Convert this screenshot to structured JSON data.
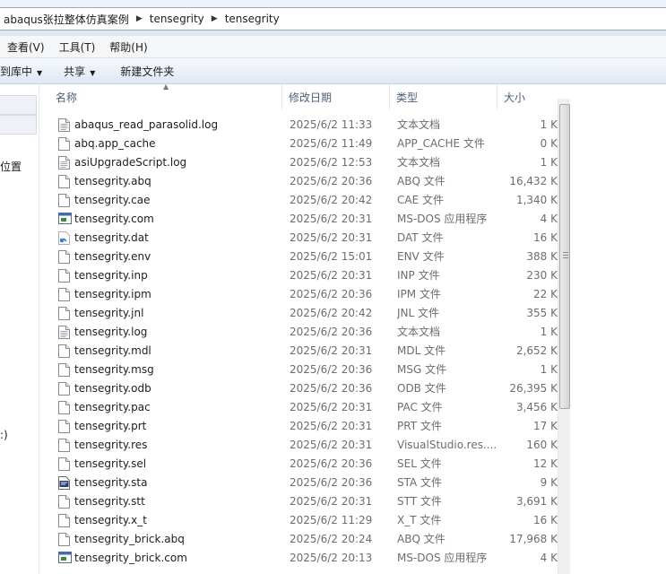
{
  "address": {
    "crumbs": [
      "abaqus张拉整体仿真案例",
      "tensegrity",
      "tensegrity"
    ]
  },
  "menu": {
    "items": [
      "查看(V)",
      "工具(T)",
      "帮助(H)"
    ]
  },
  "commands": {
    "organize": "到库中",
    "share": "共享",
    "new_folder": "新建文件夹"
  },
  "nav": {
    "partial_label1": "位置",
    "partial_label2": ":)"
  },
  "columns": {
    "name": "名称",
    "date": "修改日期",
    "type": "类型",
    "size": "大小"
  },
  "files": [
    {
      "name": "abaqus_read_parasolid.log",
      "date": "2025/6/2 11:33",
      "type": "文本文档",
      "size": "1 K",
      "icon": "text-file-icon"
    },
    {
      "name": "abq.app_cache",
      "date": "2025/6/2 11:49",
      "type": "APP_CACHE 文件",
      "size": "0 K",
      "icon": "blank-file-icon"
    },
    {
      "name": "asiUpgradeScript.log",
      "date": "2025/6/2 12:53",
      "type": "文本文档",
      "size": "1 K",
      "icon": "text-file-icon"
    },
    {
      "name": "tensegrity.abq",
      "date": "2025/6/2 20:36",
      "type": "ABQ 文件",
      "size": "16,432 K",
      "icon": "blank-file-icon"
    },
    {
      "name": "tensegrity.cae",
      "date": "2025/6/2 20:42",
      "type": "CAE 文件",
      "size": "1,340 K",
      "icon": "blank-file-icon"
    },
    {
      "name": "tensegrity.com",
      "date": "2025/6/2 20:31",
      "type": "MS-DOS 应用程序",
      "size": "4 K",
      "icon": "msdos-app-icon"
    },
    {
      "name": "tensegrity.dat",
      "date": "2025/6/2 20:31",
      "type": "DAT 文件",
      "size": "16 K",
      "icon": "dat-file-icon"
    },
    {
      "name": "tensegrity.env",
      "date": "2025/6/2 15:01",
      "type": "ENV 文件",
      "size": "388 K",
      "icon": "blank-file-icon"
    },
    {
      "name": "tensegrity.inp",
      "date": "2025/6/2 20:31",
      "type": "INP 文件",
      "size": "230 K",
      "icon": "blank-file-icon"
    },
    {
      "name": "tensegrity.ipm",
      "date": "2025/6/2 20:36",
      "type": "IPM 文件",
      "size": "22 K",
      "icon": "blank-file-icon"
    },
    {
      "name": "tensegrity.jnl",
      "date": "2025/6/2 20:42",
      "type": "JNL 文件",
      "size": "355 K",
      "icon": "blank-file-icon"
    },
    {
      "name": "tensegrity.log",
      "date": "2025/6/2 20:36",
      "type": "文本文档",
      "size": "1 K",
      "icon": "text-file-icon"
    },
    {
      "name": "tensegrity.mdl",
      "date": "2025/6/2 20:31",
      "type": "MDL 文件",
      "size": "2,652 K",
      "icon": "blank-file-icon"
    },
    {
      "name": "tensegrity.msg",
      "date": "2025/6/2 20:36",
      "type": "MSG 文件",
      "size": "1 K",
      "icon": "blank-file-icon"
    },
    {
      "name": "tensegrity.odb",
      "date": "2025/6/2 20:36",
      "type": "ODB 文件",
      "size": "26,395 K",
      "icon": "blank-file-icon"
    },
    {
      "name": "tensegrity.pac",
      "date": "2025/6/2 20:31",
      "type": "PAC 文件",
      "size": "3,456 K",
      "icon": "blank-file-icon"
    },
    {
      "name": "tensegrity.prt",
      "date": "2025/6/2 20:31",
      "type": "PRT 文件",
      "size": "17 K",
      "icon": "blank-file-icon"
    },
    {
      "name": "tensegrity.res",
      "date": "2025/6/2 20:31",
      "type": "VisualStudio.res....",
      "size": "160 K",
      "icon": "blank-file-icon"
    },
    {
      "name": "tensegrity.sel",
      "date": "2025/6/2 20:36",
      "type": "SEL 文件",
      "size": "12 K",
      "icon": "blank-file-icon"
    },
    {
      "name": "tensegrity.sta",
      "date": "2025/6/2 20:36",
      "type": "STA 文件",
      "size": "9 K",
      "icon": "sta-file-icon"
    },
    {
      "name": "tensegrity.stt",
      "date": "2025/6/2 20:31",
      "type": "STT 文件",
      "size": "3,691 K",
      "icon": "blank-file-icon"
    },
    {
      "name": "tensegrity.x_t",
      "date": "2025/6/2 11:29",
      "type": "X_T 文件",
      "size": "16 K",
      "icon": "blank-file-icon"
    },
    {
      "name": "tensegrity_brick.abq",
      "date": "2025/6/2 20:24",
      "type": "ABQ 文件",
      "size": "17,968 K",
      "icon": "blank-file-icon"
    },
    {
      "name": "tensegrity_brick.com",
      "date": "2025/6/2 20:13",
      "type": "MS-DOS 应用程序",
      "size": "4 K",
      "icon": "msdos-app-icon"
    }
  ]
}
